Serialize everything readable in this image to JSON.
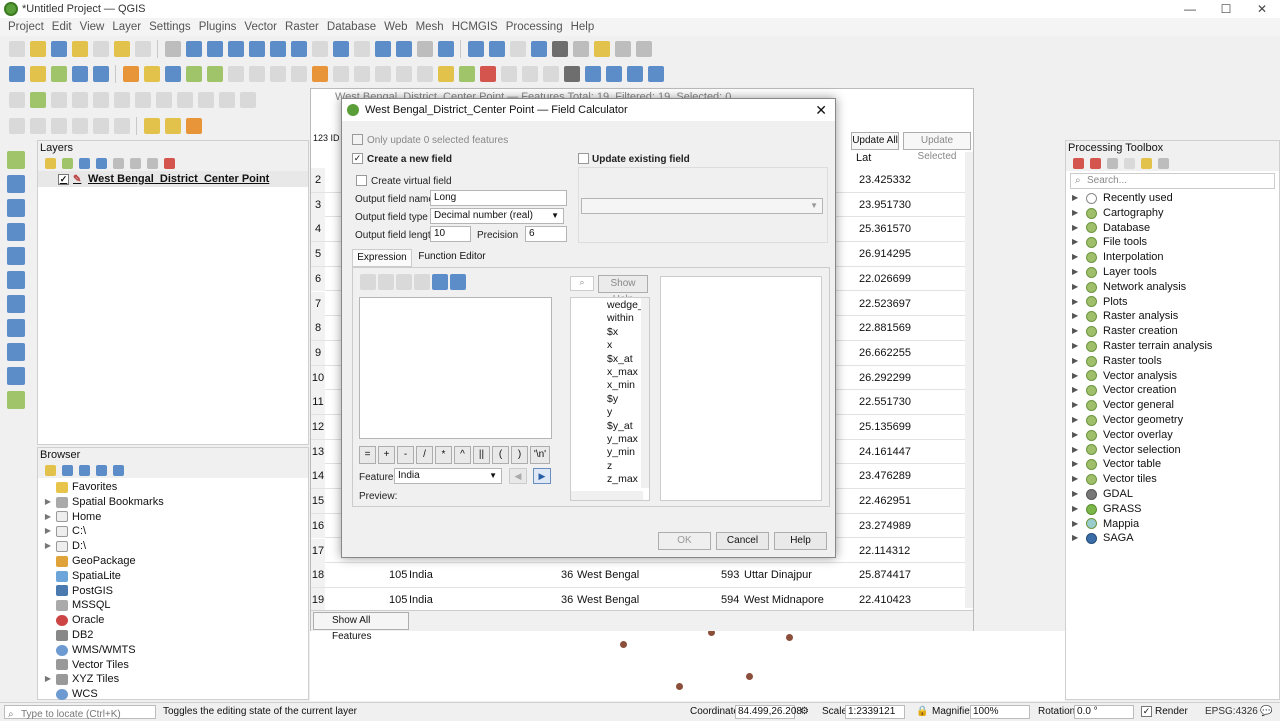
{
  "window": {
    "title": "*Untitled Project — QGIS",
    "minimize": "—",
    "maximize": "☐",
    "close": "✕"
  },
  "menu": [
    "Project",
    "Edit",
    "View",
    "Layer",
    "Settings",
    "Plugins",
    "Vector",
    "Raster",
    "Database",
    "Web",
    "Mesh",
    "HCMGIS",
    "Processing",
    "Help"
  ],
  "layers_panel": {
    "title": "Layers",
    "layer_name": "West Bengal_District_Center Point"
  },
  "browser_panel": {
    "title": "Browser",
    "items": [
      "Favorites",
      "Spatial Bookmarks",
      "Home",
      "C:\\",
      "D:\\",
      "GeoPackage",
      "SpatiaLite",
      "PostGIS",
      "MSSQL",
      "Oracle",
      "DB2",
      "WMS/WMTS",
      "Vector Tiles",
      "XYZ Tiles",
      "WCS"
    ]
  },
  "attribute_table": {
    "title": "West Bengal_District_Center Point — Features Total: 19, Filtered: 19, Selected: 0",
    "update_all": "Update All",
    "update_selected": "Update Selected",
    "col_lat": "Lat",
    "id_col": "123 ID",
    "rows": [
      {
        "n": "2",
        "lat": "23.425332"
      },
      {
        "n": "3",
        "lat": "23.951730"
      },
      {
        "n": "4",
        "lat": "25.361570"
      },
      {
        "n": "5",
        "lat": "26.914295"
      },
      {
        "n": "6",
        "lat": "22.026699"
      },
      {
        "n": "7",
        "lat": "22.523697"
      },
      {
        "n": "8",
        "lat": "22.881569"
      },
      {
        "n": "9",
        "lat": "26.662255"
      },
      {
        "n": "10",
        "lat": "26.292299"
      },
      {
        "n": "11",
        "lat": "22.551730"
      },
      {
        "n": "12",
        "lat": "25.135699"
      },
      {
        "n": "13",
        "lat": "24.161447"
      },
      {
        "n": "14",
        "lat": "23.476289"
      },
      {
        "n": "15",
        "lat": "22.462951"
      },
      {
        "n": "16",
        "lat": "23.274989"
      },
      {
        "n": "17",
        "lat": "22.114312"
      }
    ],
    "full_rows": [
      {
        "n": "18",
        "a": "105",
        "b": "India",
        "c": "36",
        "d": "West Bengal",
        "e": "593",
        "f": "Uttar Dinajpur",
        "lat": "25.874417"
      },
      {
        "n": "19",
        "a": "105",
        "b": "India",
        "c": "36",
        "d": "West Bengal",
        "e": "594",
        "f": "West Midnapore",
        "lat": "22.410423"
      }
    ],
    "show_all": "Show All Features"
  },
  "field_calc": {
    "title": "West Bengal_District_Center Point — Field Calculator",
    "only_update": "Only update 0 selected features",
    "create_new": "Create a new field",
    "update_existing": "Update existing field",
    "create_virtual": "Create virtual field",
    "output_name_label": "Output field name",
    "output_name_value": "Long",
    "output_type_label": "Output field type",
    "output_type_value": "Decimal number (real)",
    "output_length_label": "Output field length",
    "output_length_value": "10",
    "precision_label": "Precision",
    "precision_value": "6",
    "tab_expression": "Expression",
    "tab_function_editor": "Function Editor",
    "show_help": "Show Help",
    "operators": [
      "=",
      "+",
      "-",
      "/",
      "*",
      "^",
      "||",
      "(",
      ")",
      "'\\n'"
    ],
    "feature_label": "Feature",
    "feature_value": "India",
    "preview_label": "Preview:",
    "functions": [
      "wedge_buffer",
      "within",
      "$x",
      "x",
      "$x_at",
      "x_max",
      "x_min",
      "$y",
      "y",
      "$y_at",
      "y_max",
      "y_min",
      "z",
      "z_max"
    ],
    "ok": "OK",
    "cancel": "Cancel",
    "help": "Help"
  },
  "toolbox": {
    "title": "Processing Toolbox",
    "search_placeholder": "Search...",
    "items": [
      "Recently used",
      "Cartography",
      "Database",
      "File tools",
      "Interpolation",
      "Layer tools",
      "Network analysis",
      "Plots",
      "Raster analysis",
      "Raster creation",
      "Raster terrain analysis",
      "Raster tools",
      "Vector analysis",
      "Vector creation",
      "Vector general",
      "Vector geometry",
      "Vector overlay",
      "Vector selection",
      "Vector table",
      "Vector tiles",
      "GDAL",
      "GRASS",
      "Mappia",
      "SAGA"
    ]
  },
  "status": {
    "locate_placeholder": "Type to locate (Ctrl+K)",
    "message": "Toggles the editing state of the current layer",
    "coordinate_label": "Coordinate",
    "coordinate_value": "84.499,26.208",
    "scale_label": "Scale",
    "scale_value": "1:2339121",
    "magnifier_label": "Magnifier",
    "magnifier_value": "100%",
    "rotation_label": "Rotation",
    "rotation_value": "0.0 °",
    "render_label": "Render",
    "crs": "EPSG:4326"
  }
}
